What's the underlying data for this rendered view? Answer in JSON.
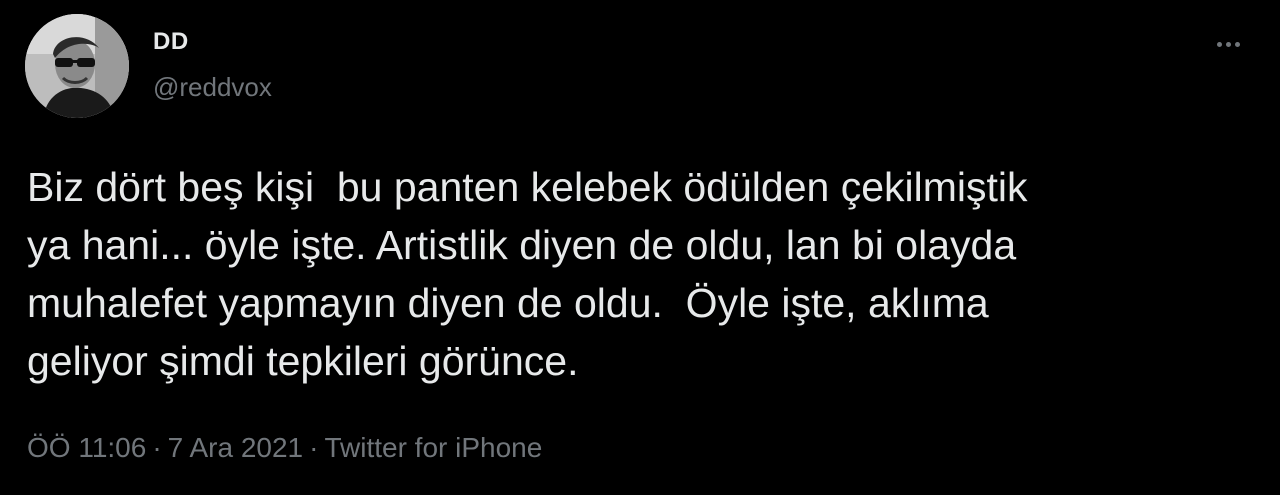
{
  "tweet": {
    "display_name": "DD",
    "handle": "@reddvox",
    "text": "Biz dört beş kişi  bu panten kelebek ödülden çekilmiştik\nya hani... öyle işte. Artistlik diyen de oldu, lan bi olayda\nmuhalefet yapmayın diyen de oldu.  Öyle işte, aklıma\ngeliyor şimdi tepkileri görünce.",
    "time": "ÖÖ 11:06",
    "separator": "·",
    "date": "7 Ara 2021",
    "source": "Twitter for iPhone",
    "more_icon": "more-horizontal-icon"
  },
  "colors": {
    "background": "#000000",
    "primary_text": "#e7e9ea",
    "secondary_text": "#71767b"
  }
}
